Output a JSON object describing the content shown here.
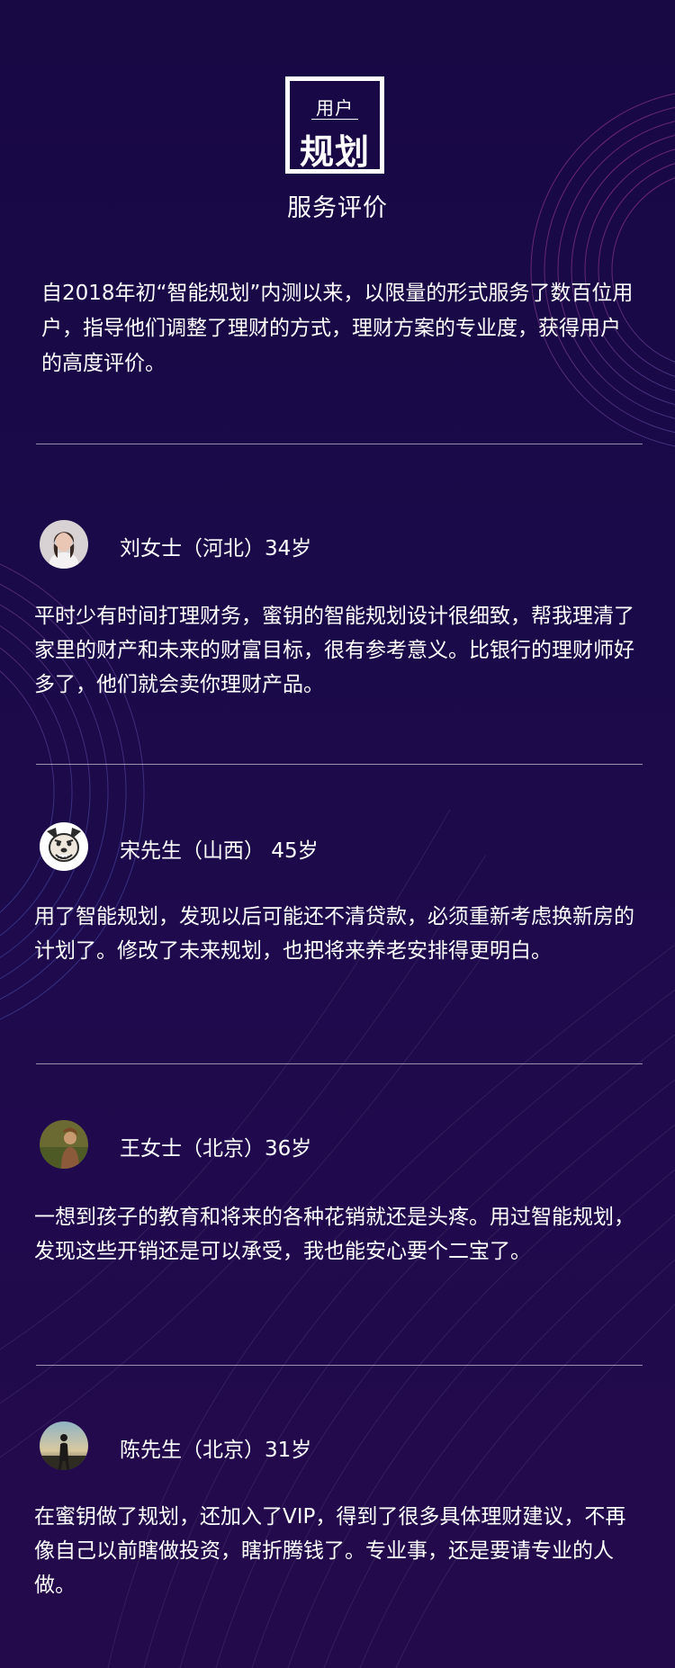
{
  "header": {
    "logo_top": "用户",
    "logo_bottom": "规划",
    "title": "服务评价"
  },
  "intro": "自2018年初“智能规划”内测以来，以限量的形式服务了数百位用户，指导他们调整了理财的方式，理财方案的专业度，获得用户的高度评价。",
  "reviews": [
    {
      "name": "刘女士（河北）34岁",
      "avatar": "portrait-woman-avatar",
      "text": "平时少有时间打理财务，蜜钥的智能规划设计很细致，帮我理清了家里的财产和未来的财富目标，很有参考意义。比银行的理财师好多了，他们就会卖你理财产品。"
    },
    {
      "name": "宋先生（山西） 45岁",
      "avatar": "dog-cartoon-avatar",
      "text": "用了智能规划，发现以后可能还不清贷款，必须重新考虑换新房的计划了。修改了未来规划，也把将来养老安排得更明白。"
    },
    {
      "name": "王女士（北京）36岁",
      "avatar": "woman-outdoor-avatar",
      "text": "一想到孩子的教育和将来的各种花销就还是头疼。用过智能规划，发现这些开销还是可以承受，我也能安心要个二宝了。"
    },
    {
      "name": "陈先生（北京）31岁",
      "avatar": "man-silhouette-avatar",
      "text": "在蜜钥做了规划，还加入了VIP，得到了很多具体理财建议，不再像自己以前瞎做投资，瞎折腾钱了。专业事，还是要请专业的人做。"
    }
  ],
  "colors": {
    "background": "#1b0a4a",
    "text": "#ffffff",
    "line_accent_pink": "#c23a8c",
    "line_accent_blue": "#3a5cc2"
  }
}
